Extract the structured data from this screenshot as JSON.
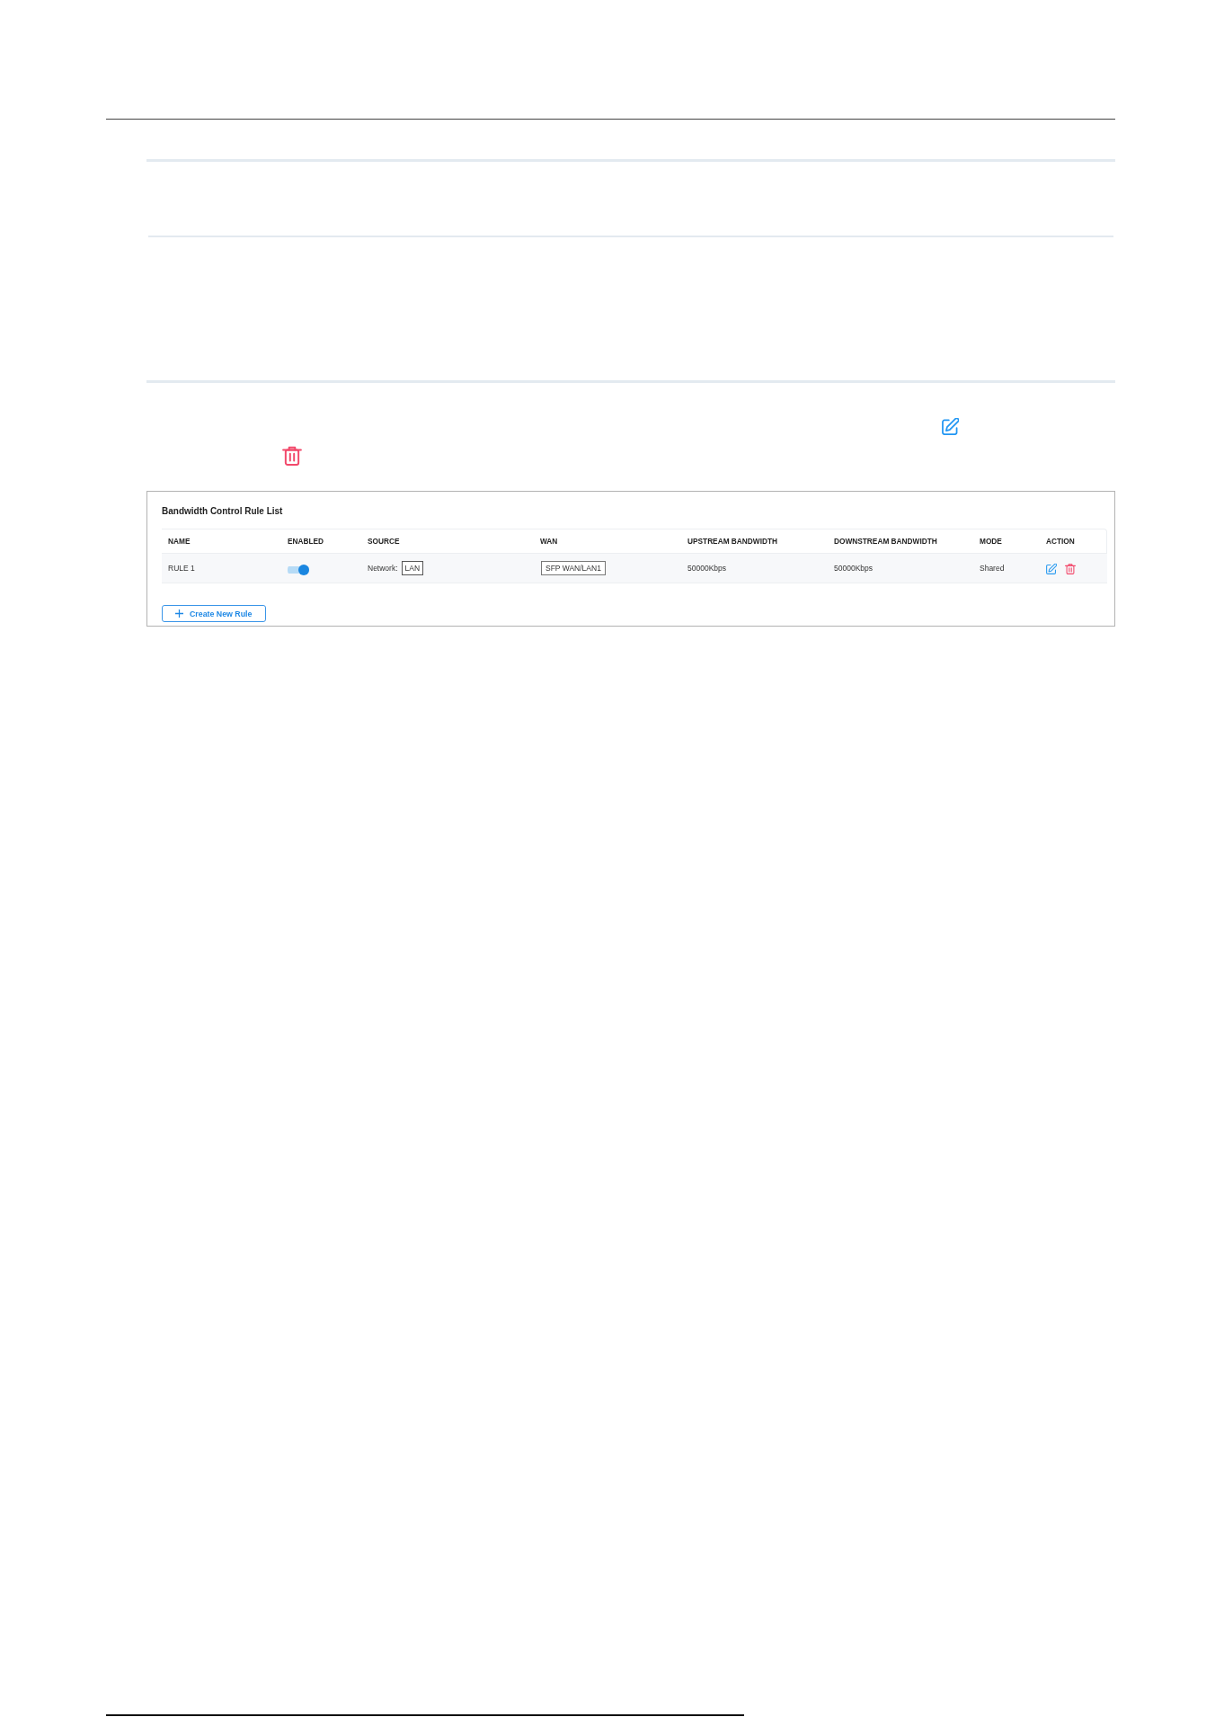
{
  "rule_list": {
    "title": "Bandwidth Control Rule List",
    "columns": [
      "NAME",
      "ENABLED",
      "SOURCE",
      "WAN",
      "UPSTREAM BANDWIDTH",
      "DOWNSTREAM BANDWIDTH",
      "MODE",
      "ACTION"
    ],
    "rows": [
      {
        "name": "RULE 1",
        "enabled": true,
        "source_label": "Network:",
        "source_tag": "LAN",
        "wan_tag": "SFP WAN/LAN1",
        "upstream": "50000Kbps",
        "downstream": "50000Kbps",
        "mode": "Shared"
      }
    ],
    "create_button": {
      "label": "Create New Rule"
    }
  }
}
